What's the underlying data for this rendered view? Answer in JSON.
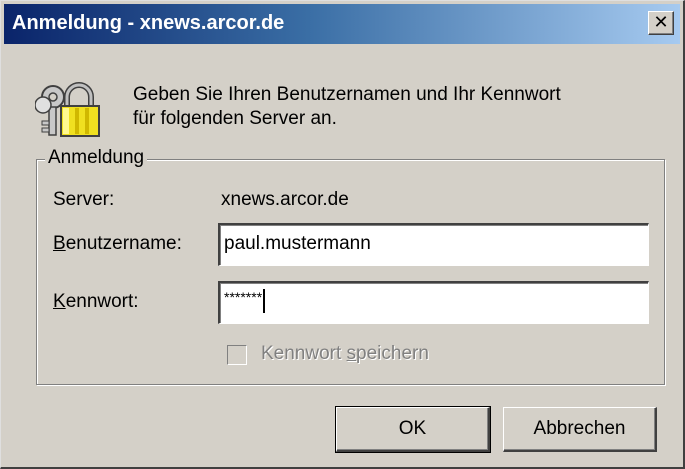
{
  "window": {
    "title": "Anmeldung - xnews.arcor.de",
    "close_glyph": "✕"
  },
  "message": {
    "line1": "Geben Sie Ihren Benutzernamen und Ihr Kennwort",
    "line2": "für folgenden Server an."
  },
  "group": {
    "legend": "Anmeldung",
    "server_label": "Server:",
    "server_value": "xnews.arcor.de",
    "username_label_access": "B",
    "username_label_rest": "enutzername:",
    "username_value": "paul.mustermann",
    "password_label_access": "K",
    "password_label_rest": "ennwort:",
    "password_value": "*******",
    "save_label_pre": "Kennwort ",
    "save_label_access": "s",
    "save_label_post": "peichern",
    "save_checked": false,
    "save_enabled": false
  },
  "buttons": {
    "ok": "OK",
    "cancel": "Abbrechen"
  },
  "icons": {
    "lock": "padlock-keys-icon"
  },
  "colors": {
    "titlebar_start": "#0a246a",
    "titlebar_end": "#a6caf0",
    "face": "#d4d0c8"
  }
}
